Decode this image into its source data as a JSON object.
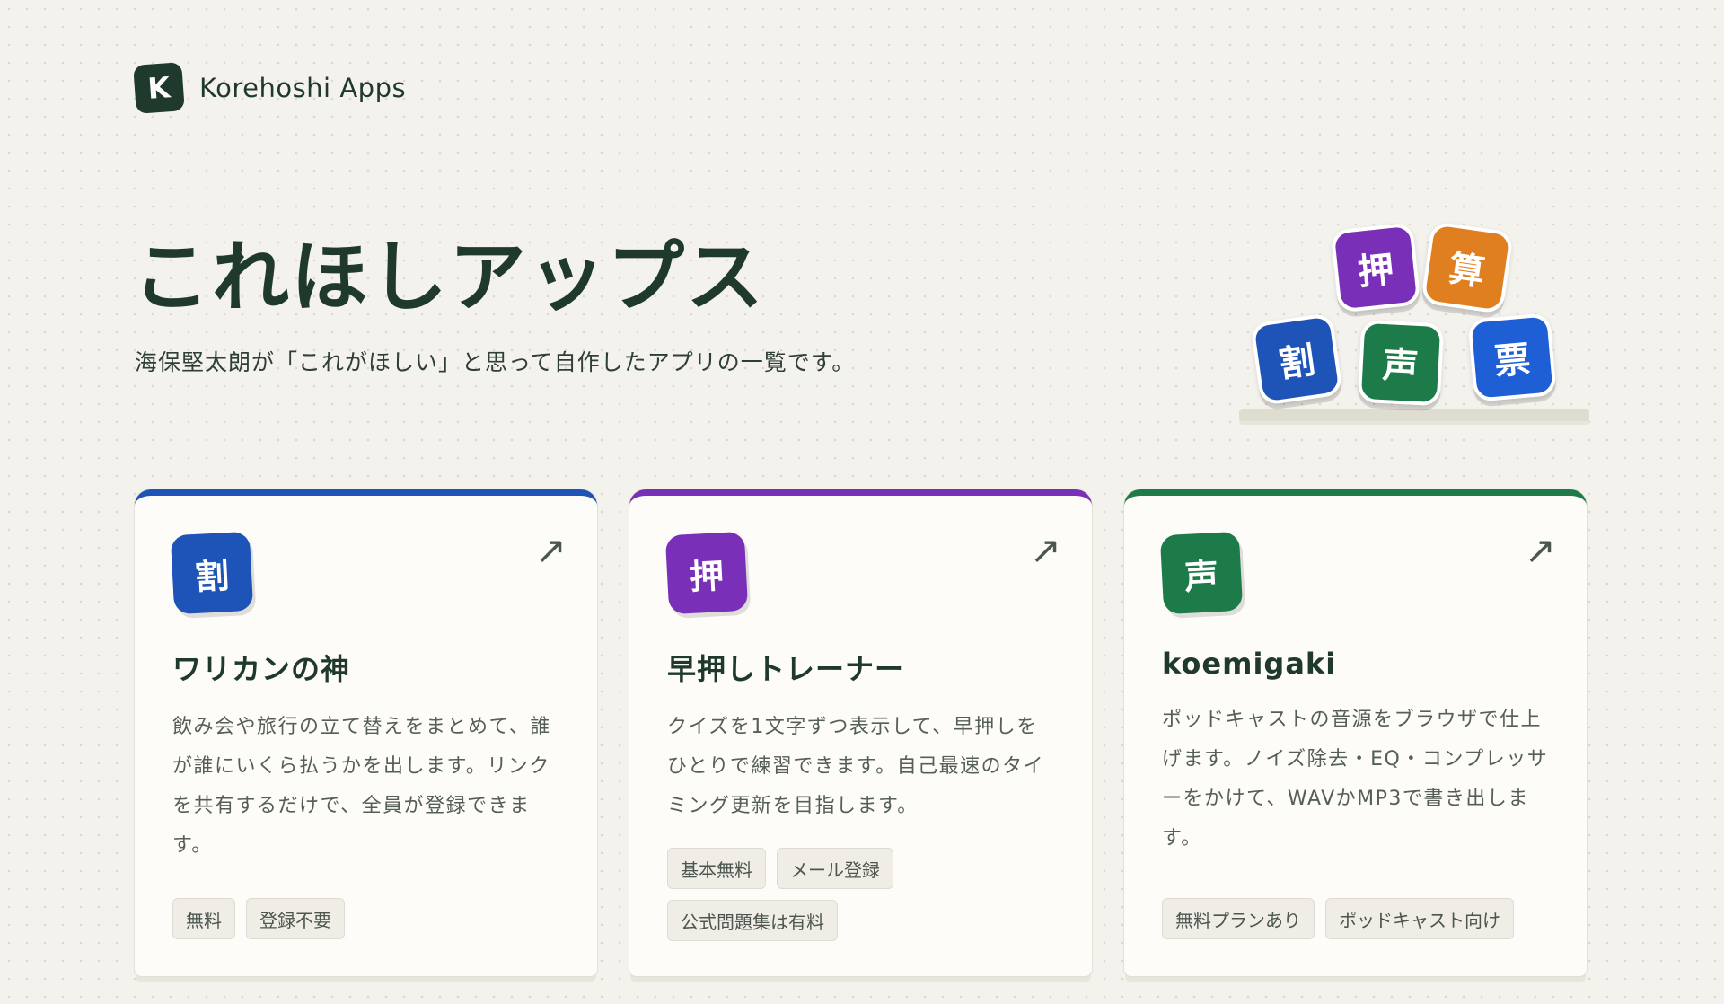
{
  "brand": {
    "logo_letter": "K",
    "name": "Korehoshi Apps"
  },
  "hero": {
    "title": "これほしアップス",
    "subtitle": "海保堅太朗が「これがほしい」と思って自作したアプリの一覧です。"
  },
  "stack_tiles": [
    {
      "label": "押",
      "color": "#7a2fb8"
    },
    {
      "label": "算",
      "color": "#e07f1f"
    },
    {
      "label": "割",
      "color": "#1e54b8"
    },
    {
      "label": "声",
      "color": "#1d7a49"
    },
    {
      "label": "票",
      "color": "#1e5fd6"
    }
  ],
  "apps": [
    {
      "icon_label": "割",
      "color": "#1e54b8",
      "title": "ワリカンの神",
      "description": "飲み会や旅行の立て替えをまとめて、誰が誰にいくら払うかを出します。リンクを共有するだけで、全員が登録できます。",
      "tags": [
        "無料",
        "登録不要"
      ],
      "arrow": "↗"
    },
    {
      "icon_label": "押",
      "color": "#7a2fb8",
      "title": "早押しトレーナー",
      "description": "クイズを1文字ずつ表示して、早押しをひとりで練習できます。自己最速のタイミング更新を目指します。",
      "tags": [
        "基本無料",
        "メール登録",
        "公式問題集は有料"
      ],
      "arrow": "↗"
    },
    {
      "icon_label": "声",
      "color": "#1d7a49",
      "title": "koemigaki",
      "description": "ポッドキャストの音源をブラウザで仕上げます。ノイズ除去・EQ・コンプレッサーをかけて、WAVかMP3で書き出します。",
      "tags": [
        "無料プランあり",
        "ポッドキャスト向け"
      ],
      "arrow": "↗"
    }
  ]
}
